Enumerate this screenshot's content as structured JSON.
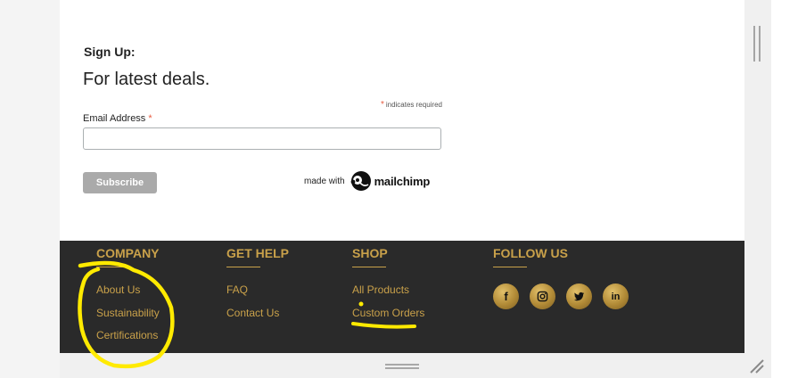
{
  "signup": {
    "heading": "Sign Up:",
    "subheading": "For latest deals.",
    "required_asterisk": "*",
    "required_note": "indicates required",
    "email_label": "Email Address",
    "email_asterisk": "*",
    "email_value": "",
    "subscribe_label": "Subscribe",
    "made_with": "made with",
    "mailchimp": "mailchimp"
  },
  "footer": {
    "company": {
      "heading": "COMPANY",
      "links": [
        "About Us",
        "Sustainability",
        "Certifications"
      ]
    },
    "get_help": {
      "heading": "GET HELP",
      "links": [
        "FAQ",
        "Contact Us"
      ]
    },
    "shop": {
      "heading": "SHOP",
      "links": [
        "All Products",
        "Custom Orders"
      ]
    },
    "follow": {
      "heading": "FOLLOW US",
      "icons": [
        "facebook-icon",
        "instagram-icon",
        "twitter-icon",
        "linkedin-icon"
      ],
      "glyphs": [
        "f",
        "",
        "",
        "in"
      ]
    }
  },
  "colors": {
    "gold": "#c9a14a",
    "footer_bg": "#2a2a2a",
    "highlighter": "#ffea00",
    "button_gray": "#aaaaaa"
  }
}
